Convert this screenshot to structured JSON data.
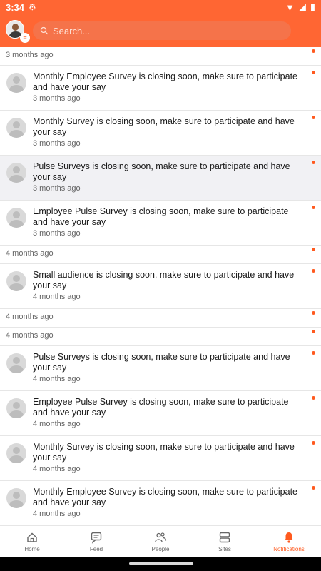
{
  "status": {
    "time": "3:34"
  },
  "search": {
    "placeholder": "Search..."
  },
  "feed": [
    {
      "kind": "sep",
      "when": "3 months ago"
    },
    {
      "kind": "item",
      "text": "Monthly Employee Survey is closing soon, make sure to participate and have your say",
      "when": "3 months ago"
    },
    {
      "kind": "item",
      "text": "Monthly Survey is closing soon, make sure to participate and have your say",
      "when": "3 months ago"
    },
    {
      "kind": "item",
      "text": "Pulse Surveys is closing soon, make sure to participate and have your say",
      "when": "3 months ago",
      "highlight": true
    },
    {
      "kind": "item",
      "text": "Employee Pulse Survey is closing soon, make sure to participate and have your say",
      "when": "3 months ago"
    },
    {
      "kind": "sep",
      "when": "4 months ago"
    },
    {
      "kind": "item",
      "text": "Small audience is closing soon, make sure to participate and have your say",
      "when": "4 months ago"
    },
    {
      "kind": "sep",
      "when": "4 months ago"
    },
    {
      "kind": "sep",
      "when": "4 months ago"
    },
    {
      "kind": "item",
      "text": "Pulse Surveys is closing soon, make sure to participate and have your say",
      "when": "4 months ago"
    },
    {
      "kind": "item",
      "text": "Employee Pulse Survey is closing soon, make sure to participate and have your say",
      "when": "4 months ago"
    },
    {
      "kind": "item",
      "text": "Monthly Survey is closing soon, make sure to participate and have your say",
      "when": "4 months ago"
    },
    {
      "kind": "item",
      "text": "Monthly Employee Survey is closing soon, make sure to participate and have your say",
      "when": "4 months ago"
    }
  ],
  "tabs": [
    {
      "label": "Home",
      "icon": "home-icon"
    },
    {
      "label": "Feed",
      "icon": "chat-icon"
    },
    {
      "label": "People",
      "icon": "people-icon"
    },
    {
      "label": "Sites",
      "icon": "sites-icon"
    },
    {
      "label": "Notifications",
      "icon": "bell-icon",
      "active": true
    }
  ],
  "colors": {
    "accent": "#ff6633",
    "unread_dot": "#ff5a1f"
  }
}
